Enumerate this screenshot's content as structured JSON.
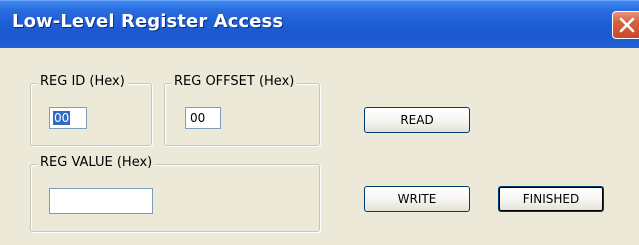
{
  "window": {
    "title": "Low-Level Register Access",
    "close_icon": "close-icon"
  },
  "reg_id": {
    "label": "REG ID (Hex)",
    "value": "00"
  },
  "reg_offset": {
    "label": "REG OFFSET (Hex)",
    "value": "00"
  },
  "reg_value": {
    "label": "REG VALUE (Hex)",
    "value": ""
  },
  "buttons": {
    "read": "READ",
    "write": "WRITE",
    "finished": "FINISHED"
  },
  "colors": {
    "title_bar": "#1f5fd6",
    "close_button": "#d8603f",
    "dialog_background": "#ece9d8",
    "selection": "#316ac5"
  }
}
